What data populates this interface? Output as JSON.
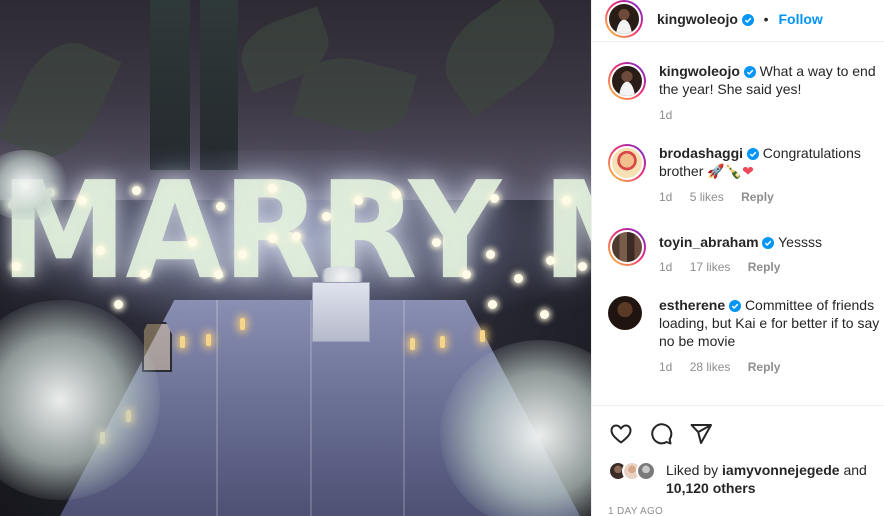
{
  "post": {
    "author": "kingwoleojo",
    "follow_label": "Follow",
    "separator": "•"
  },
  "photo": {
    "sign_text": "MARRY ME"
  },
  "caption": {
    "author": "kingwoleojo",
    "text": "What a way to end the year! She said yes!",
    "time": "1d"
  },
  "comments": [
    {
      "author": "brodashaggi",
      "text": "Congratulations brother",
      "emojis": "🚀🍾❤",
      "time": "1d",
      "likes": "5 likes",
      "reply": "Reply"
    },
    {
      "author": "toyin_abraham",
      "text": "Yessss",
      "time": "1d",
      "likes": "17 likes",
      "reply": "Reply"
    },
    {
      "author": "estherene",
      "text": "Committee of friends loading, but Kai e for better if to say no be movie",
      "time": "1d",
      "likes": "28 likes",
      "reply": "Reply"
    }
  ],
  "actions": {
    "like_icon": "heart-icon",
    "comment_icon": "comment-icon",
    "share_icon": "share-icon"
  },
  "likes": {
    "prefix": "Liked by",
    "user": "iamyvonnejegede",
    "conj": "and",
    "others": "10,120 others"
  },
  "date": "1 DAY AGO",
  "colors": {
    "accent": "#0095f6",
    "verified": "#0095f6",
    "heart": "#ed4956"
  }
}
